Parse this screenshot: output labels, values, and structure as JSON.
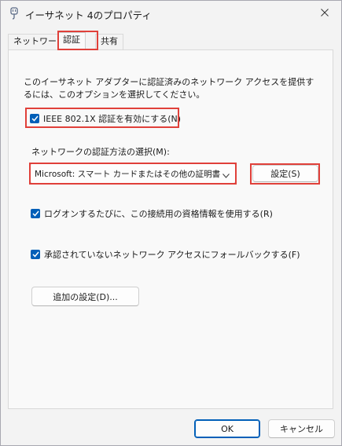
{
  "window": {
    "title": "イーサネット 4のプロパティ",
    "icon": "network-adapter-icon",
    "close_glyph": "✕"
  },
  "tabs": [
    {
      "label": "ネットワーク",
      "active": false
    },
    {
      "label": "認証",
      "active": true
    },
    {
      "label": "共有",
      "active": false
    }
  ],
  "panel": {
    "description": "このイーサネット アダプターに認証済みのネットワーク アクセスを提供するには、このオプションを選択してください。",
    "enable_8021x": {
      "label": "IEEE 802.1X 認証を有効にする(N)",
      "checked": true
    },
    "method_label": "ネットワークの認証方法の選択(M):",
    "method_select": {
      "value": "Microsoft: スマート カードまたはその他の証明書 (E"
    },
    "settings_button": "設定(S)",
    "remember_credentials": {
      "label": "ログオンするたびに、この接続用の資格情報を使用する(R)",
      "checked": true
    },
    "fallback": {
      "label": "承認されていないネットワーク アクセスにフォールバックする(F)",
      "checked": true
    },
    "additional_settings_button": "追加の設定(D)..."
  },
  "footer": {
    "ok": "OK",
    "cancel": "キャンセル"
  },
  "colors": {
    "accent": "#005fb8",
    "highlight": "#e0403a",
    "background": "#f3f3f3"
  }
}
